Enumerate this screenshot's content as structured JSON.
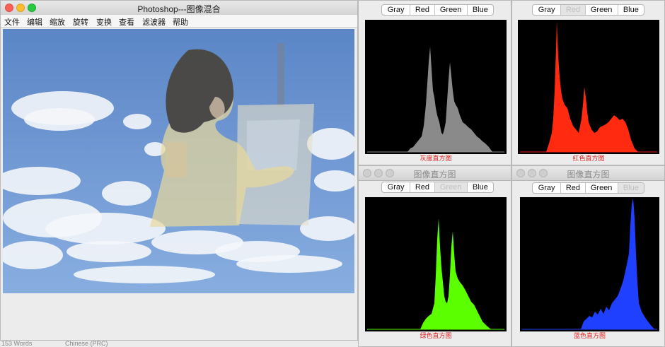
{
  "main_window": {
    "title": "Photoshop---图像混合",
    "menu": [
      "文件",
      "编辑",
      "缩放",
      "旋转",
      "变换",
      "查看",
      "滤波器",
      "帮助"
    ]
  },
  "histogram_windows": [
    {
      "id": "gray",
      "title": "",
      "buttons": [
        "Gray",
        "Red",
        "Green",
        "Blue"
      ],
      "selected": "Gray",
      "caption": "灰度直方图",
      "color": "#808080"
    },
    {
      "id": "red",
      "title": "",
      "buttons": [
        "Gray",
        "Red",
        "Green",
        "Blue"
      ],
      "selected": "Red",
      "caption": "红色直方图",
      "color": "#ff2a10"
    },
    {
      "id": "green",
      "title": "图像直方图",
      "buttons": [
        "Gray",
        "Red",
        "Green",
        "Blue"
      ],
      "selected": "Green",
      "caption": "绿色直方图",
      "color": "#5cff00"
    },
    {
      "id": "blue",
      "title": "图像直方图",
      "buttons": [
        "Gray",
        "Red",
        "Green",
        "Blue"
      ],
      "selected": "Blue",
      "caption": "蓝色直方图",
      "color": "#2040ff"
    }
  ],
  "status_bar": {
    "words": "153 Words",
    "language": "Chinese (PRC)"
  }
}
